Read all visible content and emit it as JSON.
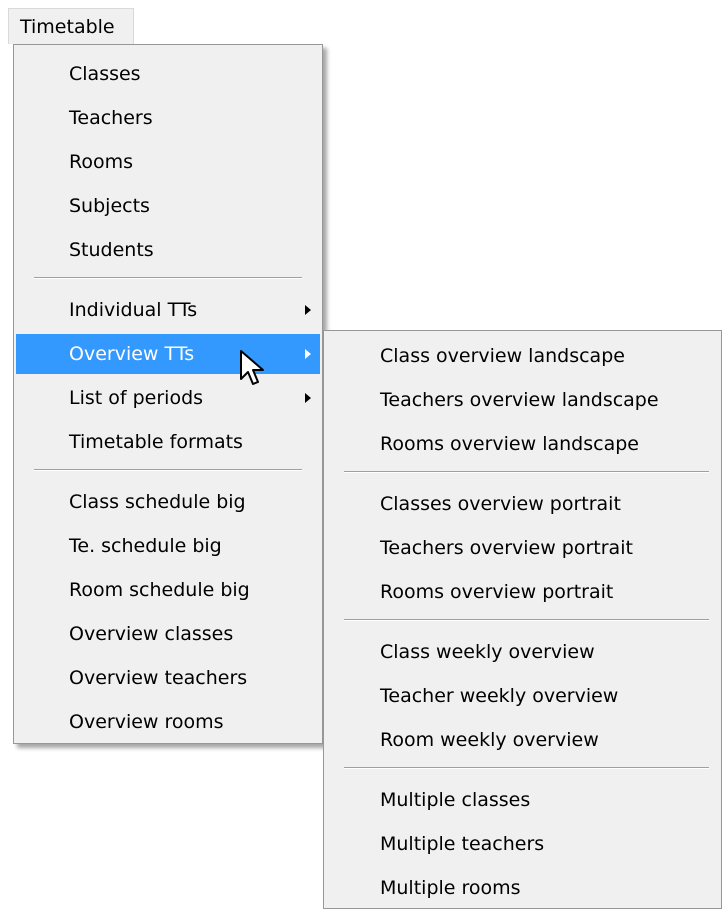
{
  "menubar": {
    "label": "Timetable"
  },
  "main_menu": {
    "items": [
      {
        "label": "Classes"
      },
      {
        "label": "Teachers"
      },
      {
        "label": "Rooms"
      },
      {
        "label": "Subjects"
      },
      {
        "label": "Students"
      },
      {
        "label": "Individual TTs",
        "submenu": true
      },
      {
        "label": "Overview TTs",
        "submenu": true,
        "highlighted": true
      },
      {
        "label": "List of periods",
        "submenu": true
      },
      {
        "label": "Timetable formats"
      },
      {
        "label": "Class schedule big"
      },
      {
        "label": "Te. schedule big"
      },
      {
        "label": "Room schedule big"
      },
      {
        "label": "Overview classes"
      },
      {
        "label": "Overview teachers"
      },
      {
        "label": "Overview rooms"
      }
    ]
  },
  "submenu": {
    "items": [
      {
        "label": "Class overview landscape"
      },
      {
        "label": "Teachers overview landscape"
      },
      {
        "label": "Rooms overview landscape"
      },
      {
        "label": "Classes overview portrait"
      },
      {
        "label": "Teachers overview portrait"
      },
      {
        "label": "Rooms overview portrait"
      },
      {
        "label": "Class weekly overview"
      },
      {
        "label": "Teacher weekly overview"
      },
      {
        "label": "Room weekly overview"
      },
      {
        "label": "Multiple classes"
      },
      {
        "label": "Multiple teachers"
      },
      {
        "label": "Multiple rooms"
      }
    ]
  },
  "colors": {
    "highlight": "#3399ff",
    "menu_bg": "#f0f0f0"
  },
  "icons": {
    "cursor": "mouse-pointer-icon",
    "submenu_arrow": "chevron-right-icon"
  }
}
